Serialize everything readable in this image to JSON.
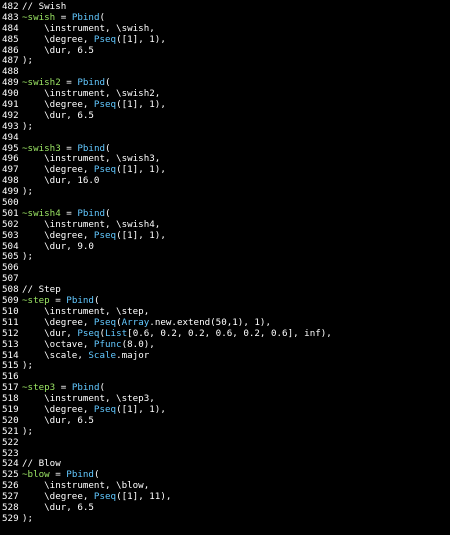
{
  "colors": {
    "background": "#000000",
    "text": "#ffffff",
    "env_variable": "#9be564",
    "class_name": "#62c8ff"
  },
  "lines": [
    {
      "n": "482",
      "tokens": [
        [
          "cmt",
          "// Swish"
        ]
      ]
    },
    {
      "n": "483",
      "tokens": [
        [
          "env",
          "~swish"
        ],
        [
          "plain",
          " = "
        ],
        [
          "cls",
          "Pbind"
        ],
        [
          "plain",
          "("
        ]
      ]
    },
    {
      "n": "484",
      "tokens": [
        [
          "plain",
          "    \\instrument, \\swish,"
        ]
      ]
    },
    {
      "n": "485",
      "tokens": [
        [
          "plain",
          "    \\degree, "
        ],
        [
          "cls",
          "Pseq"
        ],
        [
          "plain",
          "([1], 1),"
        ]
      ]
    },
    {
      "n": "486",
      "tokens": [
        [
          "plain",
          "    \\dur, 6.5"
        ]
      ]
    },
    {
      "n": "487",
      "tokens": [
        [
          "plain",
          ");"
        ]
      ]
    },
    {
      "n": "488",
      "tokens": []
    },
    {
      "n": "489",
      "tokens": [
        [
          "env",
          "~swish2"
        ],
        [
          "plain",
          " = "
        ],
        [
          "cls",
          "Pbind"
        ],
        [
          "plain",
          "("
        ]
      ]
    },
    {
      "n": "490",
      "tokens": [
        [
          "plain",
          "    \\instrument, \\swish2,"
        ]
      ]
    },
    {
      "n": "491",
      "tokens": [
        [
          "plain",
          "    \\degree, "
        ],
        [
          "cls",
          "Pseq"
        ],
        [
          "plain",
          "([1], 1),"
        ]
      ]
    },
    {
      "n": "492",
      "tokens": [
        [
          "plain",
          "    \\dur, 6.5"
        ]
      ]
    },
    {
      "n": "493",
      "tokens": [
        [
          "plain",
          ");"
        ]
      ]
    },
    {
      "n": "494",
      "tokens": []
    },
    {
      "n": "495",
      "tokens": [
        [
          "env",
          "~swish3"
        ],
        [
          "plain",
          " = "
        ],
        [
          "cls",
          "Pbind"
        ],
        [
          "plain",
          "("
        ]
      ]
    },
    {
      "n": "496",
      "tokens": [
        [
          "plain",
          "    \\instrument, \\swish3,"
        ]
      ]
    },
    {
      "n": "497",
      "tokens": [
        [
          "plain",
          "    \\degree, "
        ],
        [
          "cls",
          "Pseq"
        ],
        [
          "plain",
          "([1], 1),"
        ]
      ]
    },
    {
      "n": "498",
      "tokens": [
        [
          "plain",
          "    \\dur, 16.0"
        ]
      ]
    },
    {
      "n": "499",
      "tokens": [
        [
          "plain",
          ");"
        ]
      ]
    },
    {
      "n": "500",
      "tokens": []
    },
    {
      "n": "501",
      "tokens": [
        [
          "env",
          "~swish4"
        ],
        [
          "plain",
          " = "
        ],
        [
          "cls",
          "Pbind"
        ],
        [
          "plain",
          "("
        ]
      ]
    },
    {
      "n": "502",
      "tokens": [
        [
          "plain",
          "    \\instrument, \\swish4,"
        ]
      ]
    },
    {
      "n": "503",
      "tokens": [
        [
          "plain",
          "    \\degree, "
        ],
        [
          "cls",
          "Pseq"
        ],
        [
          "plain",
          "([1], 1),"
        ]
      ]
    },
    {
      "n": "504",
      "tokens": [
        [
          "plain",
          "    \\dur, 9.0"
        ]
      ]
    },
    {
      "n": "505",
      "tokens": [
        [
          "plain",
          ");"
        ]
      ]
    },
    {
      "n": "506",
      "tokens": []
    },
    {
      "n": "507",
      "tokens": []
    },
    {
      "n": "508",
      "tokens": [
        [
          "cmt",
          "// Step"
        ]
      ]
    },
    {
      "n": "509",
      "tokens": [
        [
          "env",
          "~step"
        ],
        [
          "plain",
          " = "
        ],
        [
          "cls",
          "Pbind"
        ],
        [
          "plain",
          "("
        ]
      ]
    },
    {
      "n": "510",
      "tokens": [
        [
          "plain",
          "    \\instrument, \\step,"
        ]
      ]
    },
    {
      "n": "511",
      "tokens": [
        [
          "plain",
          "    \\degree, "
        ],
        [
          "cls",
          "Pseq"
        ],
        [
          "plain",
          "("
        ],
        [
          "cls",
          "Array"
        ],
        [
          "plain",
          ".new.extend(50,1), 1),"
        ]
      ]
    },
    {
      "n": "512",
      "tokens": [
        [
          "plain",
          "    \\dur, "
        ],
        [
          "cls",
          "Pseq"
        ],
        [
          "plain",
          "("
        ],
        [
          "cls",
          "List"
        ],
        [
          "plain",
          "[0.6, 0.2, 0.2, 0.6, 0.2, 0.6], inf),"
        ]
      ]
    },
    {
      "n": "513",
      "tokens": [
        [
          "plain",
          "    \\octave, "
        ],
        [
          "cls",
          "Pfunc"
        ],
        [
          "plain",
          "(8.0),"
        ]
      ]
    },
    {
      "n": "514",
      "tokens": [
        [
          "plain",
          "    \\scale, "
        ],
        [
          "cls",
          "Scale"
        ],
        [
          "plain",
          ".major"
        ]
      ]
    },
    {
      "n": "515",
      "tokens": [
        [
          "plain",
          ");"
        ]
      ]
    },
    {
      "n": "516",
      "tokens": []
    },
    {
      "n": "517",
      "tokens": [
        [
          "env",
          "~step3"
        ],
        [
          "plain",
          " = "
        ],
        [
          "cls",
          "Pbind"
        ],
        [
          "plain",
          "("
        ]
      ]
    },
    {
      "n": "518",
      "tokens": [
        [
          "plain",
          "    \\instrument, \\step3,"
        ]
      ]
    },
    {
      "n": "519",
      "tokens": [
        [
          "plain",
          "    \\degree, "
        ],
        [
          "cls",
          "Pseq"
        ],
        [
          "plain",
          "([1], 1),"
        ]
      ]
    },
    {
      "n": "520",
      "tokens": [
        [
          "plain",
          "    \\dur, 6.5"
        ]
      ]
    },
    {
      "n": "521",
      "tokens": [
        [
          "plain",
          ");"
        ]
      ]
    },
    {
      "n": "522",
      "tokens": []
    },
    {
      "n": "523",
      "tokens": []
    },
    {
      "n": "524",
      "tokens": [
        [
          "cmt",
          "// Blow"
        ]
      ]
    },
    {
      "n": "525",
      "tokens": [
        [
          "env",
          "~blow"
        ],
        [
          "plain",
          " = "
        ],
        [
          "cls",
          "Pbind"
        ],
        [
          "plain",
          "("
        ]
      ]
    },
    {
      "n": "526",
      "tokens": [
        [
          "plain",
          "    \\instrument, \\blow,"
        ]
      ]
    },
    {
      "n": "527",
      "tokens": [
        [
          "plain",
          "    \\degree, "
        ],
        [
          "cls",
          "Pseq"
        ],
        [
          "plain",
          "([1], 11),"
        ]
      ]
    },
    {
      "n": "528",
      "tokens": [
        [
          "plain",
          "    \\dur, 6.5"
        ]
      ]
    },
    {
      "n": "529",
      "tokens": [
        [
          "plain",
          ");"
        ]
      ]
    }
  ]
}
